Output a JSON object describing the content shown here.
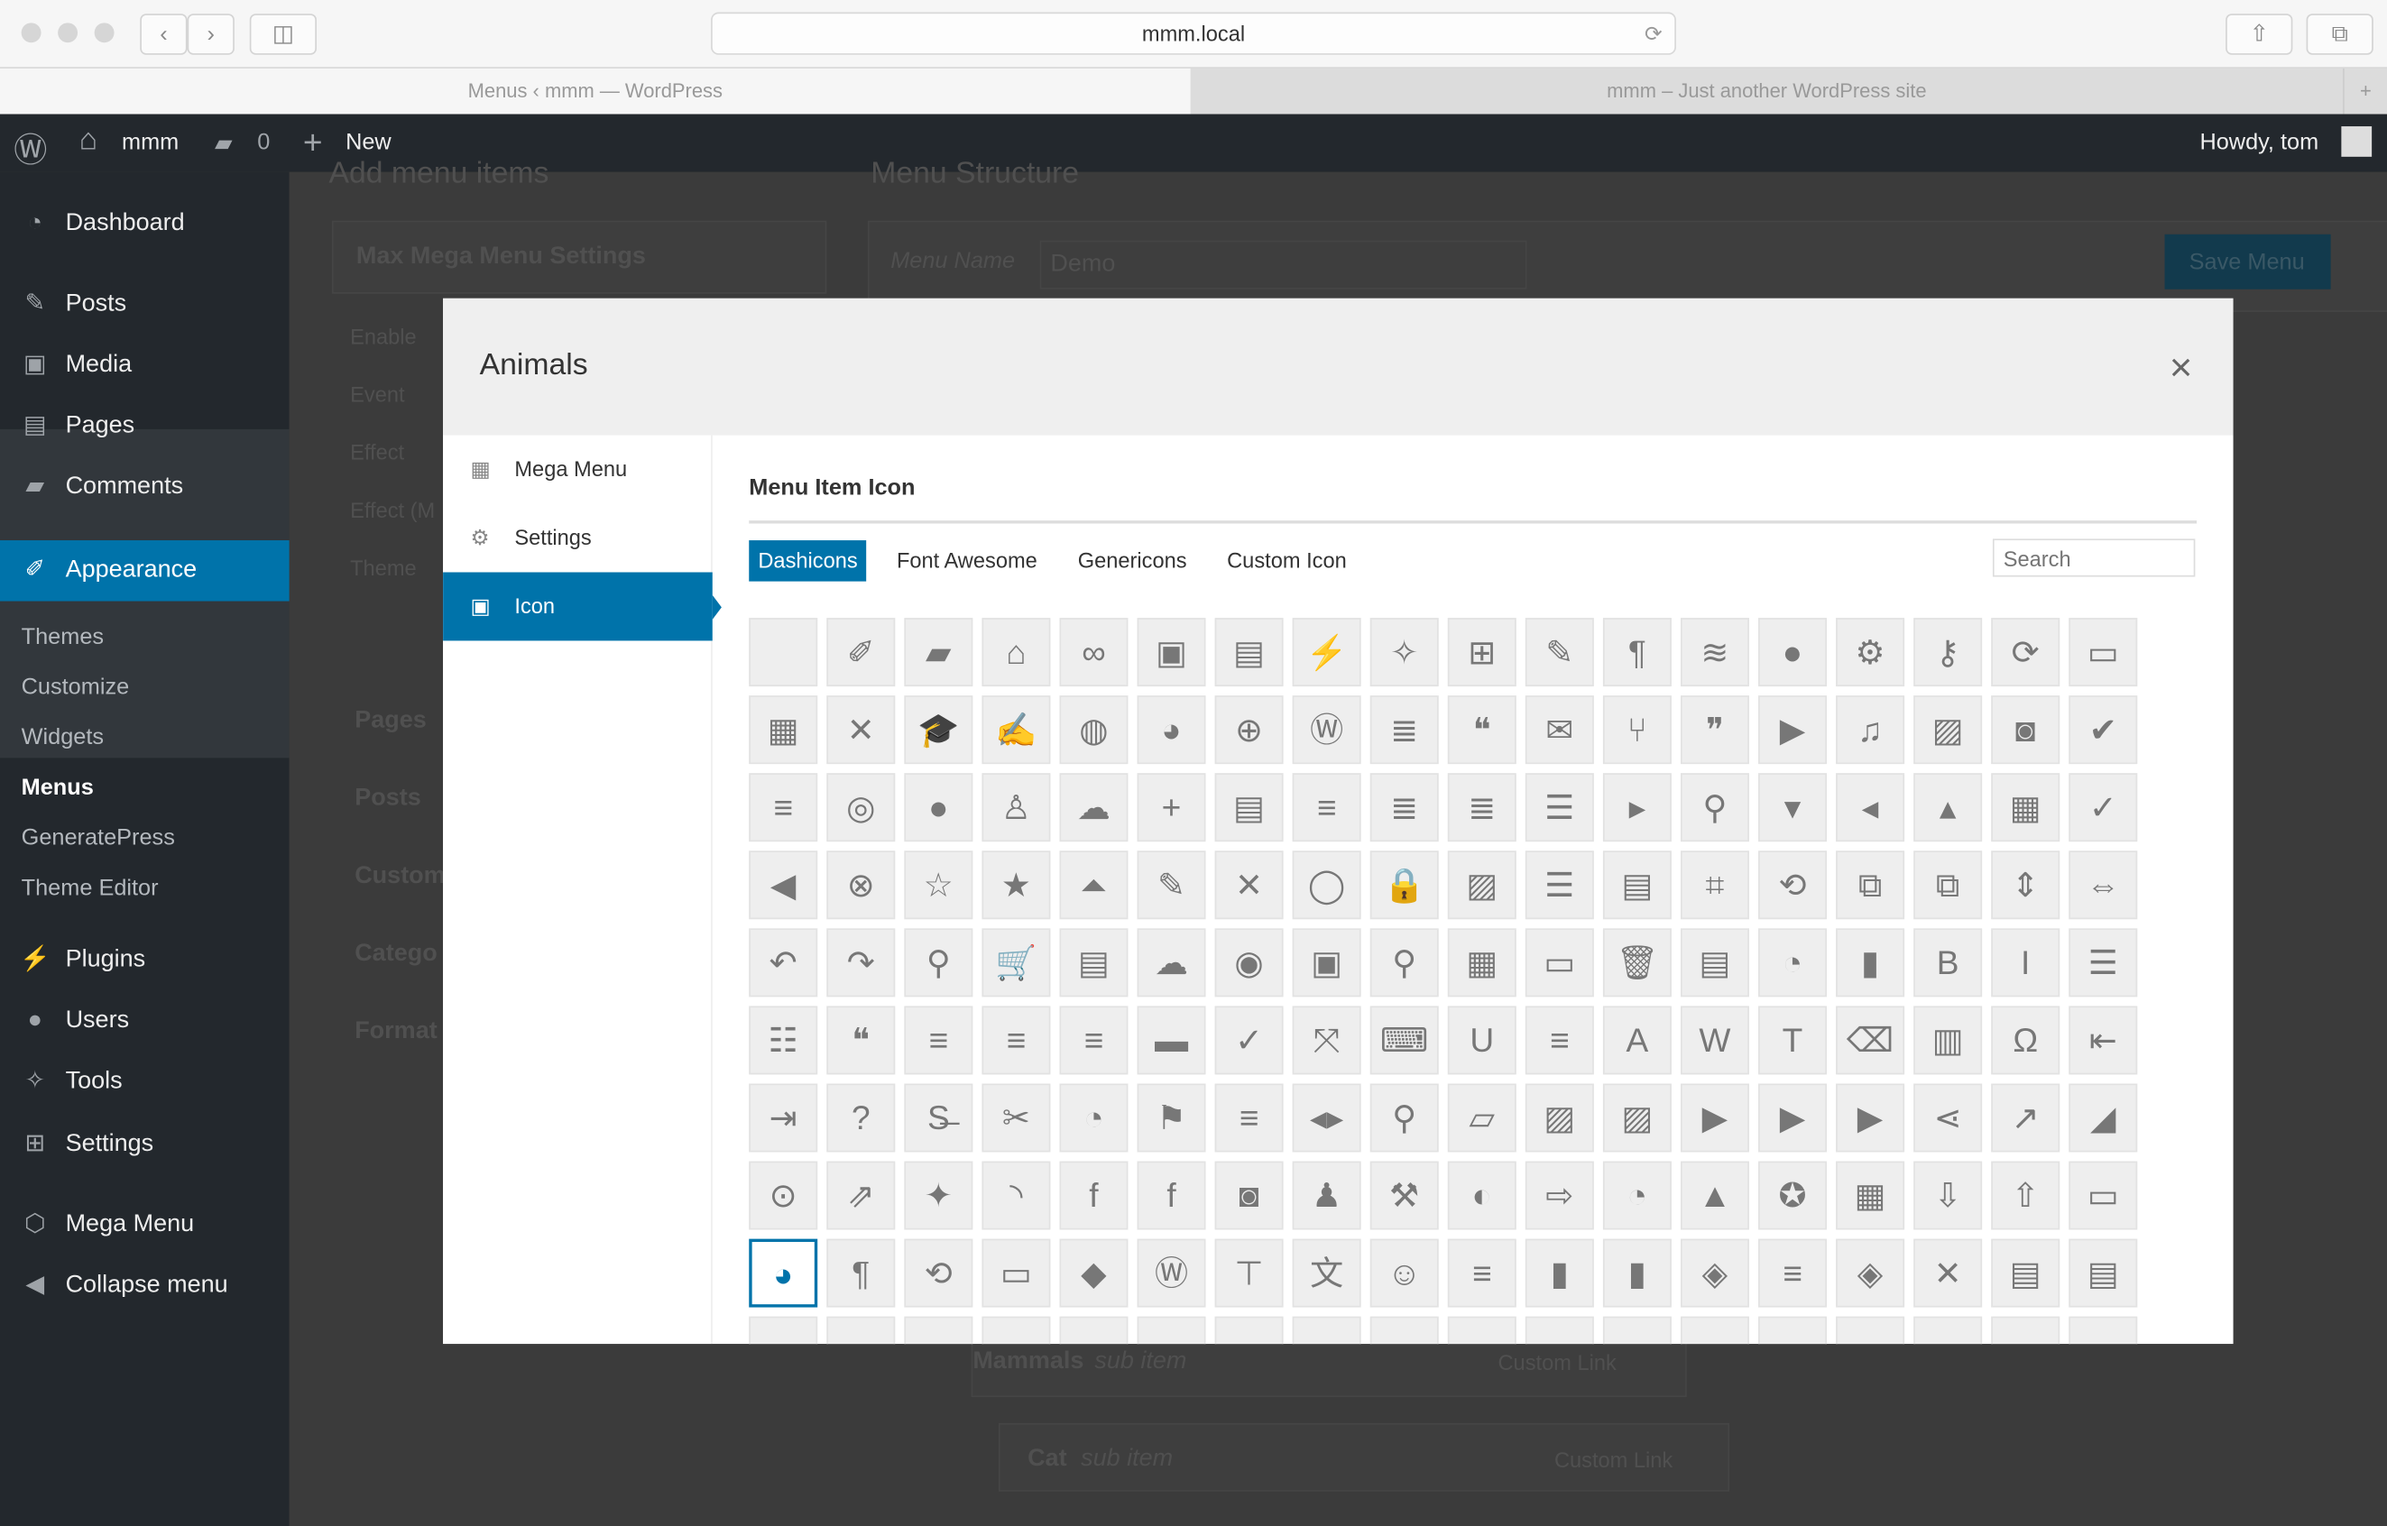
{
  "browser": {
    "url": "mmm.local",
    "tabs": [
      "Menus ‹ mmm — WordPress",
      "mmm – Just another WordPress site"
    ]
  },
  "adminbar": {
    "site": "mmm",
    "comments": "0",
    "new": "New",
    "howdy": "Howdy, tom"
  },
  "sidebar": {
    "items": [
      {
        "label": "Dashboard",
        "icon": "dashboard-icon",
        "glyph": "◔"
      },
      {
        "label": "Posts",
        "icon": "pin-icon",
        "glyph": "✎"
      },
      {
        "label": "Media",
        "icon": "media-icon",
        "glyph": "▣"
      },
      {
        "label": "Pages",
        "icon": "pages-icon",
        "glyph": "▤"
      },
      {
        "label": "Comments",
        "icon": "comment-icon",
        "glyph": "▰"
      },
      {
        "label": "Appearance",
        "icon": "brush-icon",
        "glyph": "✐"
      },
      {
        "label": "Plugins",
        "icon": "plugin-icon",
        "glyph": "⚡"
      },
      {
        "label": "Users",
        "icon": "users-icon",
        "glyph": "●"
      },
      {
        "label": "Tools",
        "icon": "wrench-icon",
        "glyph": "✧"
      },
      {
        "label": "Settings",
        "icon": "settings-icon",
        "glyph": "⊞"
      },
      {
        "label": "Mega Menu",
        "icon": "mega-menu-icon",
        "glyph": "⬡"
      },
      {
        "label": "Collapse menu",
        "icon": "collapse-icon",
        "glyph": "◀"
      }
    ],
    "submenu": [
      "Themes",
      "Customize",
      "Widgets",
      "Menus",
      "GeneratePress",
      "Theme Editor"
    ],
    "active_sub": "Menus"
  },
  "background": {
    "add_items": "Add menu items",
    "structure": "Menu Structure",
    "settings_title": "Max Mega Menu Settings",
    "settings_labels": [
      "Enable",
      "Event",
      "Effect",
      "Effect (M",
      "Theme"
    ],
    "panels": [
      "Pages",
      "Posts",
      "Custom",
      "Catego",
      "Format"
    ],
    "menu_name_label": "Menu Name",
    "menu_name_value": "Demo",
    "save": "Save Menu",
    "items": [
      {
        "title": "Mammals",
        "sub": "sub item",
        "type": "Custom Link"
      },
      {
        "title": "Cat",
        "sub": "sub item",
        "type": "Custom Link"
      }
    ]
  },
  "modal": {
    "title": "Animals",
    "close": "×",
    "nav": [
      {
        "label": "Mega Menu",
        "glyph": "▦"
      },
      {
        "label": "Settings",
        "glyph": "⚙"
      },
      {
        "label": "Icon",
        "glyph": "▣"
      }
    ],
    "active_nav": "Icon",
    "section_title": "Menu Item Icon",
    "icon_tabs": [
      "Dashicons",
      "Font Awesome",
      "Genericons",
      "Custom Icon"
    ],
    "active_icon_tab": "Dashicons",
    "search_placeholder": "Search",
    "accent": "#0073aa",
    "selected_icon": "admin-site",
    "icons": [
      [
        "blank",
        ""
      ],
      [
        "admin-appearance",
        "✐"
      ],
      [
        "admin-comments",
        "▰"
      ],
      [
        "admin-home",
        "⌂"
      ],
      [
        "admin-links",
        "∞"
      ],
      [
        "admin-media",
        "▣"
      ],
      [
        "admin-page",
        "▤"
      ],
      [
        "admin-plugins",
        "⚡"
      ],
      [
        "admin-tools",
        "✧"
      ],
      [
        "admin-settings",
        "⊞"
      ],
      [
        "admin-post",
        "✎"
      ],
      [
        "editor-ltr",
        "¶"
      ],
      [
        "admin-customizer",
        "≋"
      ],
      [
        "admin-users",
        "●"
      ],
      [
        "admin-generic",
        "⚙"
      ],
      [
        "admin-network",
        "⚷"
      ],
      [
        "update",
        "⟳"
      ],
      [
        "screenoptions",
        "▭"
      ],
      [
        "welcome-widgets-menus",
        "▦"
      ],
      [
        "dismiss-comment",
        "✕"
      ],
      [
        "welcome-learn-more",
        "🎓"
      ],
      [
        "welcome-write-blog",
        "✍"
      ],
      [
        "admin-site-alt",
        "◍"
      ],
      [
        "admin-site-alt2",
        "◕"
      ],
      [
        "translation-globe",
        "⊕"
      ],
      [
        "wordpress",
        "Ⓦ"
      ],
      [
        "format-aside",
        "≣"
      ],
      [
        "format-quote",
        "❝"
      ],
      [
        "format-status",
        "✉"
      ],
      [
        "format-gallery",
        "⑂"
      ],
      [
        "format-chat",
        "❞"
      ],
      [
        "format-video",
        "▶"
      ],
      [
        "format-audio",
        "♫"
      ],
      [
        "format-image",
        "▨"
      ],
      [
        "camera",
        "◙"
      ],
      [
        "yes-alt",
        "✔"
      ],
      [
        "editor-ol-rtl",
        "≡"
      ],
      [
        "instagram",
        "◎"
      ],
      [
        "user",
        "●"
      ],
      [
        "businessperson",
        "♙"
      ],
      [
        "testimonial",
        "☁"
      ],
      [
        "plus",
        "+"
      ],
      [
        "welcome-add-page",
        "▤"
      ],
      [
        "align-center",
        "≡"
      ],
      [
        "align-right",
        "≣"
      ],
      [
        "align-left",
        "≣"
      ],
      [
        "align-none",
        "☰"
      ],
      [
        "arrow-right",
        "▸"
      ],
      [
        "search-zoom",
        "⚲"
      ],
      [
        "arrow-down",
        "▾"
      ],
      [
        "arrow-left",
        "◂"
      ],
      [
        "arrow-up",
        "▴"
      ],
      [
        "calendar",
        "▦"
      ],
      [
        "yes",
        "✓"
      ],
      [
        "arrow-left-alt",
        "◀"
      ],
      [
        "dismiss",
        "⊗"
      ],
      [
        "star-empty",
        "☆"
      ],
      [
        "star-filled",
        "★"
      ],
      [
        "arrows-vertical",
        "⏶"
      ],
      [
        "edit-page",
        "✎"
      ],
      [
        "no",
        "✕"
      ],
      [
        "marker",
        "◯"
      ],
      [
        "lock",
        "🔒"
      ],
      [
        "format-image-alt",
        "▨"
      ],
      [
        "list-view",
        "☰"
      ],
      [
        "excerpt-view",
        "▤"
      ],
      [
        "image-crop",
        "⌗"
      ],
      [
        "image-rotate",
        "⟲"
      ],
      [
        "image-flip",
        "⧉"
      ],
      [
        "image-filter",
        "⧉"
      ],
      [
        "image-flip-vertical",
        "⇕"
      ],
      [
        "image-flip-horizontal",
        "⇔"
      ],
      [
        "undo",
        "↶"
      ],
      [
        "redo",
        "↷"
      ],
      [
        "location-pin",
        "⚲"
      ],
      [
        "cart",
        "🛒"
      ],
      [
        "feedback",
        "▤"
      ],
      [
        "cloud",
        "☁"
      ],
      [
        "visibility",
        "◉"
      ],
      [
        "vault",
        "▣"
      ],
      [
        "search",
        "⚲"
      ],
      [
        "screenoptions-grid",
        "▦"
      ],
      [
        "slides",
        "▭"
      ],
      [
        "trash",
        "🗑"
      ],
      [
        "analytics",
        "▤"
      ],
      [
        "chart-pie",
        "◔"
      ],
      [
        "chart-bar",
        "▮"
      ],
      [
        "editor-bold",
        "B"
      ],
      [
        "editor-italic",
        "I"
      ],
      [
        "editor-ul",
        "☰"
      ],
      [
        "editor-ol",
        "☷"
      ],
      [
        "editor-quote",
        "❝"
      ],
      [
        "editor-alignleft",
        "≡"
      ],
      [
        "editor-aligncenter",
        "≡"
      ],
      [
        "editor-alignright",
        "≡"
      ],
      [
        "editor-insertmore",
        "▬"
      ],
      [
        "editor-spellcheck",
        "✓"
      ],
      [
        "editor-expand",
        "⤧"
      ],
      [
        "editor-kitchensink",
        "⌨"
      ],
      [
        "editor-underline",
        "U"
      ],
      [
        "editor-justify",
        "≡"
      ],
      [
        "editor-textcolor",
        "A"
      ],
      [
        "editor-paste-word",
        "W"
      ],
      [
        "editor-paste-text",
        "T"
      ],
      [
        "editor-removeformatting",
        "⌫"
      ],
      [
        "editor-video",
        "▥"
      ],
      [
        "editor-customchar",
        "Ω"
      ],
      [
        "editor-outdent",
        "⇤"
      ],
      [
        "editor-indent",
        "⇥"
      ],
      [
        "editor-help",
        "?"
      ],
      [
        "editor-strikethrough",
        "S̶"
      ],
      [
        "editor-unlink",
        "✂"
      ],
      [
        "dashboard",
        "◔"
      ],
      [
        "flag",
        "⚑"
      ],
      [
        "menu",
        "≡"
      ],
      [
        "leftright",
        "◂▸"
      ],
      [
        "location",
        "⚲"
      ],
      [
        "location-alt",
        "▱"
      ],
      [
        "images-alt",
        "▨"
      ],
      [
        "images-alt2",
        "▨"
      ],
      [
        "video-alt",
        "▶"
      ],
      [
        "video-alt2",
        "▶"
      ],
      [
        "video-alt3",
        "▶"
      ],
      [
        "share",
        "⋖"
      ],
      [
        "chart-line",
        "↗"
      ],
      [
        "chart-area",
        "◢"
      ],
      [
        "share-alt",
        "⊙"
      ],
      [
        "share-alt2",
        "⇗"
      ],
      [
        "twitter",
        "✦"
      ],
      [
        "rss",
        "◝"
      ],
      [
        "facebook",
        "f"
      ],
      [
        "facebook-alt",
        "f"
      ],
      [
        "camera-alt",
        "◙"
      ],
      [
        "groups",
        "♟"
      ],
      [
        "hammer",
        "⚒"
      ],
      [
        "art",
        "◐"
      ],
      [
        "migrate",
        "⇨"
      ],
      [
        "performance",
        "◔"
      ],
      [
        "products",
        "▲"
      ],
      [
        "awards",
        "✪"
      ],
      [
        "forms",
        "▦"
      ],
      [
        "download",
        "⇩"
      ],
      [
        "upload",
        "⇧"
      ],
      [
        "category",
        "▭"
      ],
      [
        "admin-site",
        "◕"
      ],
      [
        "editor-rtl",
        "¶"
      ],
      [
        "backup",
        "⟲"
      ],
      [
        "portfolio",
        "▭"
      ],
      [
        "tag",
        "◆"
      ],
      [
        "wordpress-alt",
        "Ⓦ"
      ],
      [
        "networking",
        "⊤"
      ],
      [
        "translation",
        "文"
      ],
      [
        "smiley",
        "☺"
      ],
      [
        "menu-alt",
        "≡"
      ],
      [
        "book",
        "▮"
      ],
      [
        "book-alt",
        "▮"
      ],
      [
        "shield-alt",
        "◈"
      ],
      [
        "menu-alt3",
        "≡"
      ],
      [
        "shield",
        "◈"
      ],
      [
        "no-alt",
        "✕"
      ],
      [
        "id",
        "▤"
      ],
      [
        "id-alt",
        "▤"
      ]
    ]
  }
}
